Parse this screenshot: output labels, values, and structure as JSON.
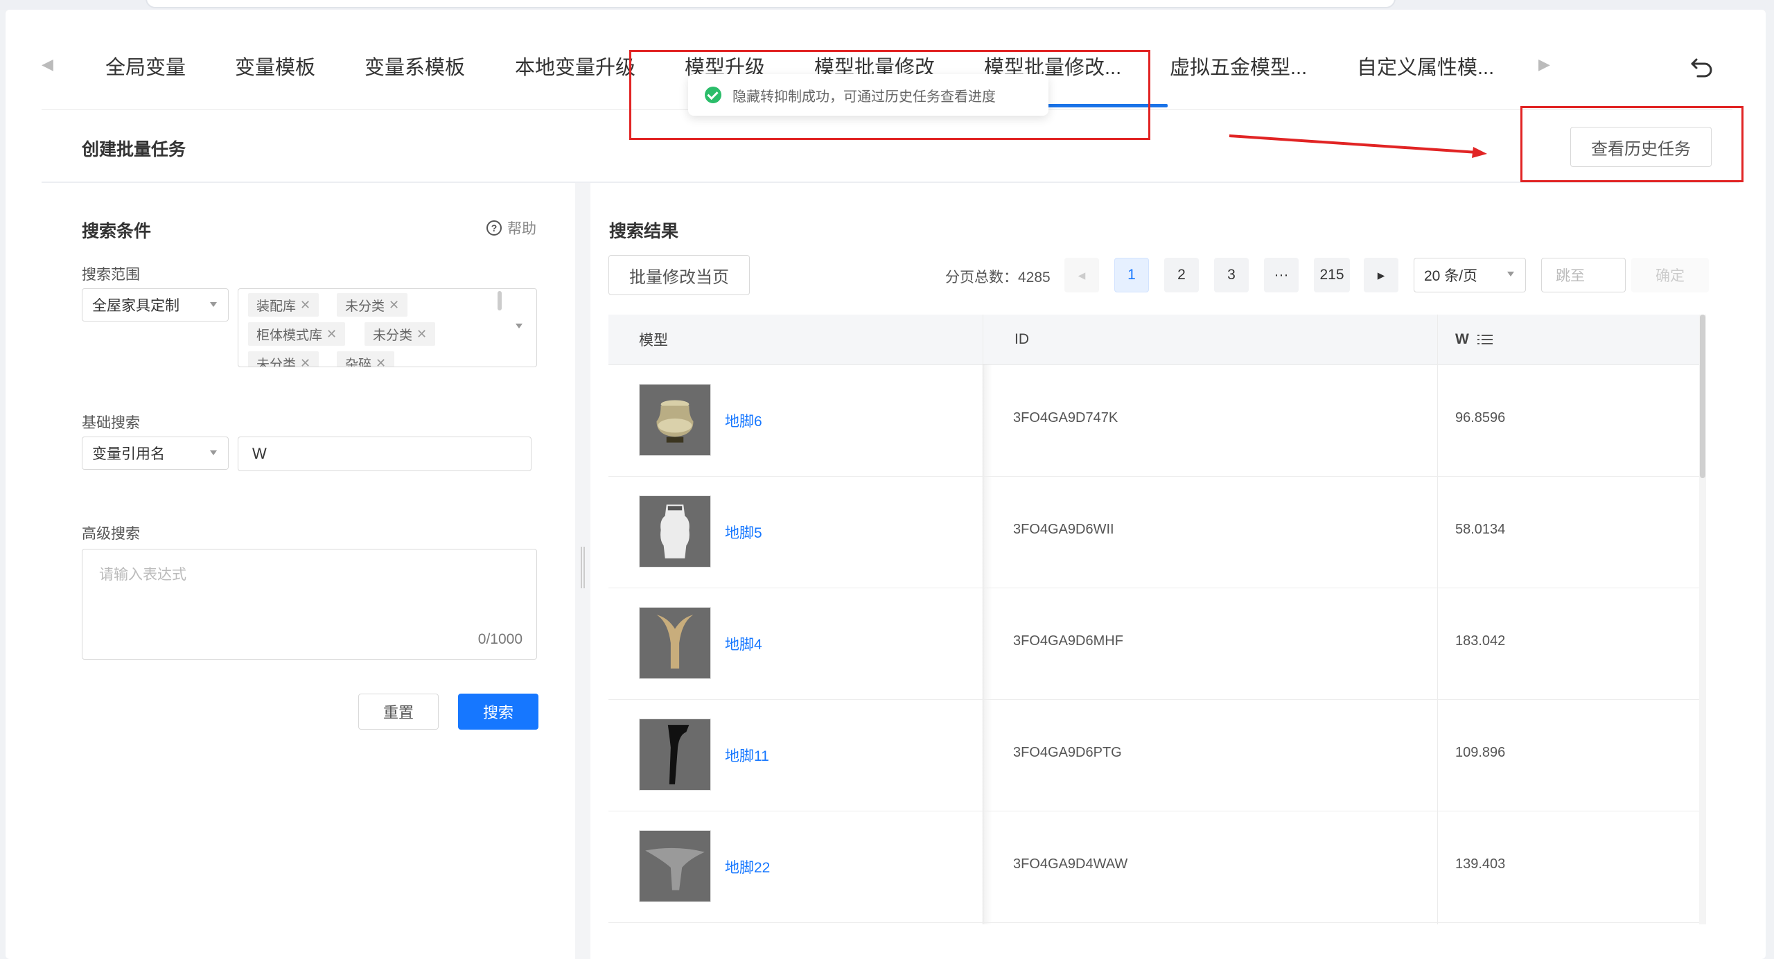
{
  "tabs": {
    "items": [
      "全局变量",
      "变量模板",
      "变量系模板",
      "本地变量升级",
      "模型升级",
      "模型批量修改",
      "模型批量修改...",
      "虚拟五金模型...",
      "自定义属性模..."
    ],
    "active_index": 6
  },
  "toast": {
    "message": "隐藏转抑制成功，可通过历史任务查看进度"
  },
  "header": {
    "title": "创建批量任务",
    "history_button": "查看历史任务"
  },
  "search": {
    "title": "搜索条件",
    "help": "帮助",
    "scope_label": "搜索范围",
    "scope_value": "全屋家具定制",
    "scope_tags": [
      "装配库",
      "未分类",
      "柜体模式库",
      "未分类",
      "未分类",
      "杂碎"
    ],
    "basic_label": "基础搜索",
    "basic_type": "变量引用名",
    "basic_value": "W",
    "advanced_label": "高级搜索",
    "advanced_placeholder": "请输入表达式",
    "advanced_count": "0/1000",
    "reset_button": "重置",
    "search_button": "搜索"
  },
  "results": {
    "title": "搜索结果",
    "batch_button": "批量修改当页",
    "total_label": "分页总数：4285",
    "pages": [
      "1",
      "2",
      "3",
      "···",
      "215"
    ],
    "page_size": "20 条/页",
    "jump_placeholder": "跳至",
    "confirm": "确定",
    "columns": [
      "模型",
      "ID",
      "W"
    ],
    "rows": [
      {
        "name": "地脚6",
        "id": "3FO4GA9D747K",
        "w": "96.8596"
      },
      {
        "name": "地脚5",
        "id": "3FO4GA9D6WII",
        "w": "58.0134"
      },
      {
        "name": "地脚4",
        "id": "3FO4GA9D6MHF",
        "w": "183.042"
      },
      {
        "name": "地脚11",
        "id": "3FO4GA9D6PTG",
        "w": "109.896"
      },
      {
        "name": "地脚22",
        "id": "3FO4GA9D4WAW",
        "w": "139.403"
      }
    ]
  },
  "colors": {
    "accent": "#1677ff",
    "success": "#2bbd6a",
    "annotation": "#e12424"
  }
}
